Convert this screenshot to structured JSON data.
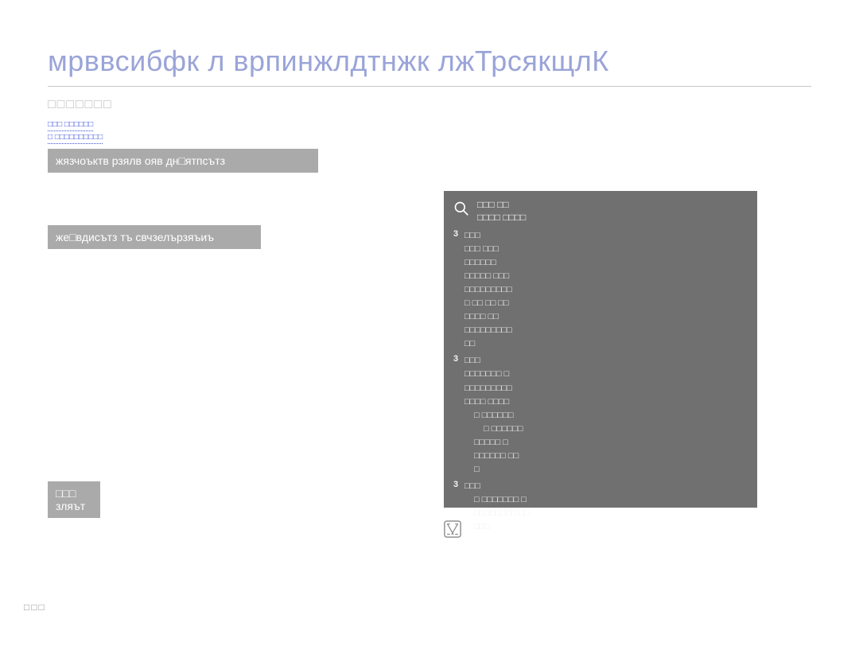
{
  "title": "мрввсибфк л врпинжлдтнжк лжТрсякщлК",
  "sub_heading": "□□□□□□□",
  "links": {
    "line1": "□□□ □□□□□□",
    "line2": "□ □□□□□□□□□□"
  },
  "bars": {
    "b1": "жязчоъктв рзялв ояв дн□ятпсътз",
    "b2": "же□вдисътз тъ свчзелързяъиъ",
    "b3": "□□□ зляът"
  },
  "sidebox": {
    "title1": "□□□ □□",
    "title2": "□□□□ □□□□",
    "items": [
      {
        "num": "3",
        "lines": [
          "□□□",
          "□□□ □□□",
          "□□□□□□",
          "□□□□□ □□□",
          "□□□□□□□□□",
          "□ □□ □□ □□",
          "□□□□ □□",
          "□□□□□□□□□",
          "□□"
        ]
      },
      {
        "num": "3",
        "lines": [
          "□□□",
          "□□□□□□□ □",
          "□□□□□□□□□",
          "□□□□ □□□□",
          {
            "text": "□   □□□□□□",
            "indent": 1
          },
          {
            "text": "□ □□□□□□",
            "indent": 2
          },
          {
            "text": "□□□□□ □",
            "indent": 1
          },
          {
            "text": "□□□□□□ □□",
            "indent": 1
          },
          {
            "text": "□",
            "indent": 1
          }
        ]
      },
      {
        "num": "3",
        "lines": [
          "□□□",
          {
            "text": "□    □□□□□□□  □",
            "indent": 1
          },
          {
            "text": "□□□□□□□□ □□",
            "indent": 1
          },
          {
            "text": "□□□",
            "indent": 1
          }
        ]
      }
    ]
  },
  "pagenum": "□□□"
}
